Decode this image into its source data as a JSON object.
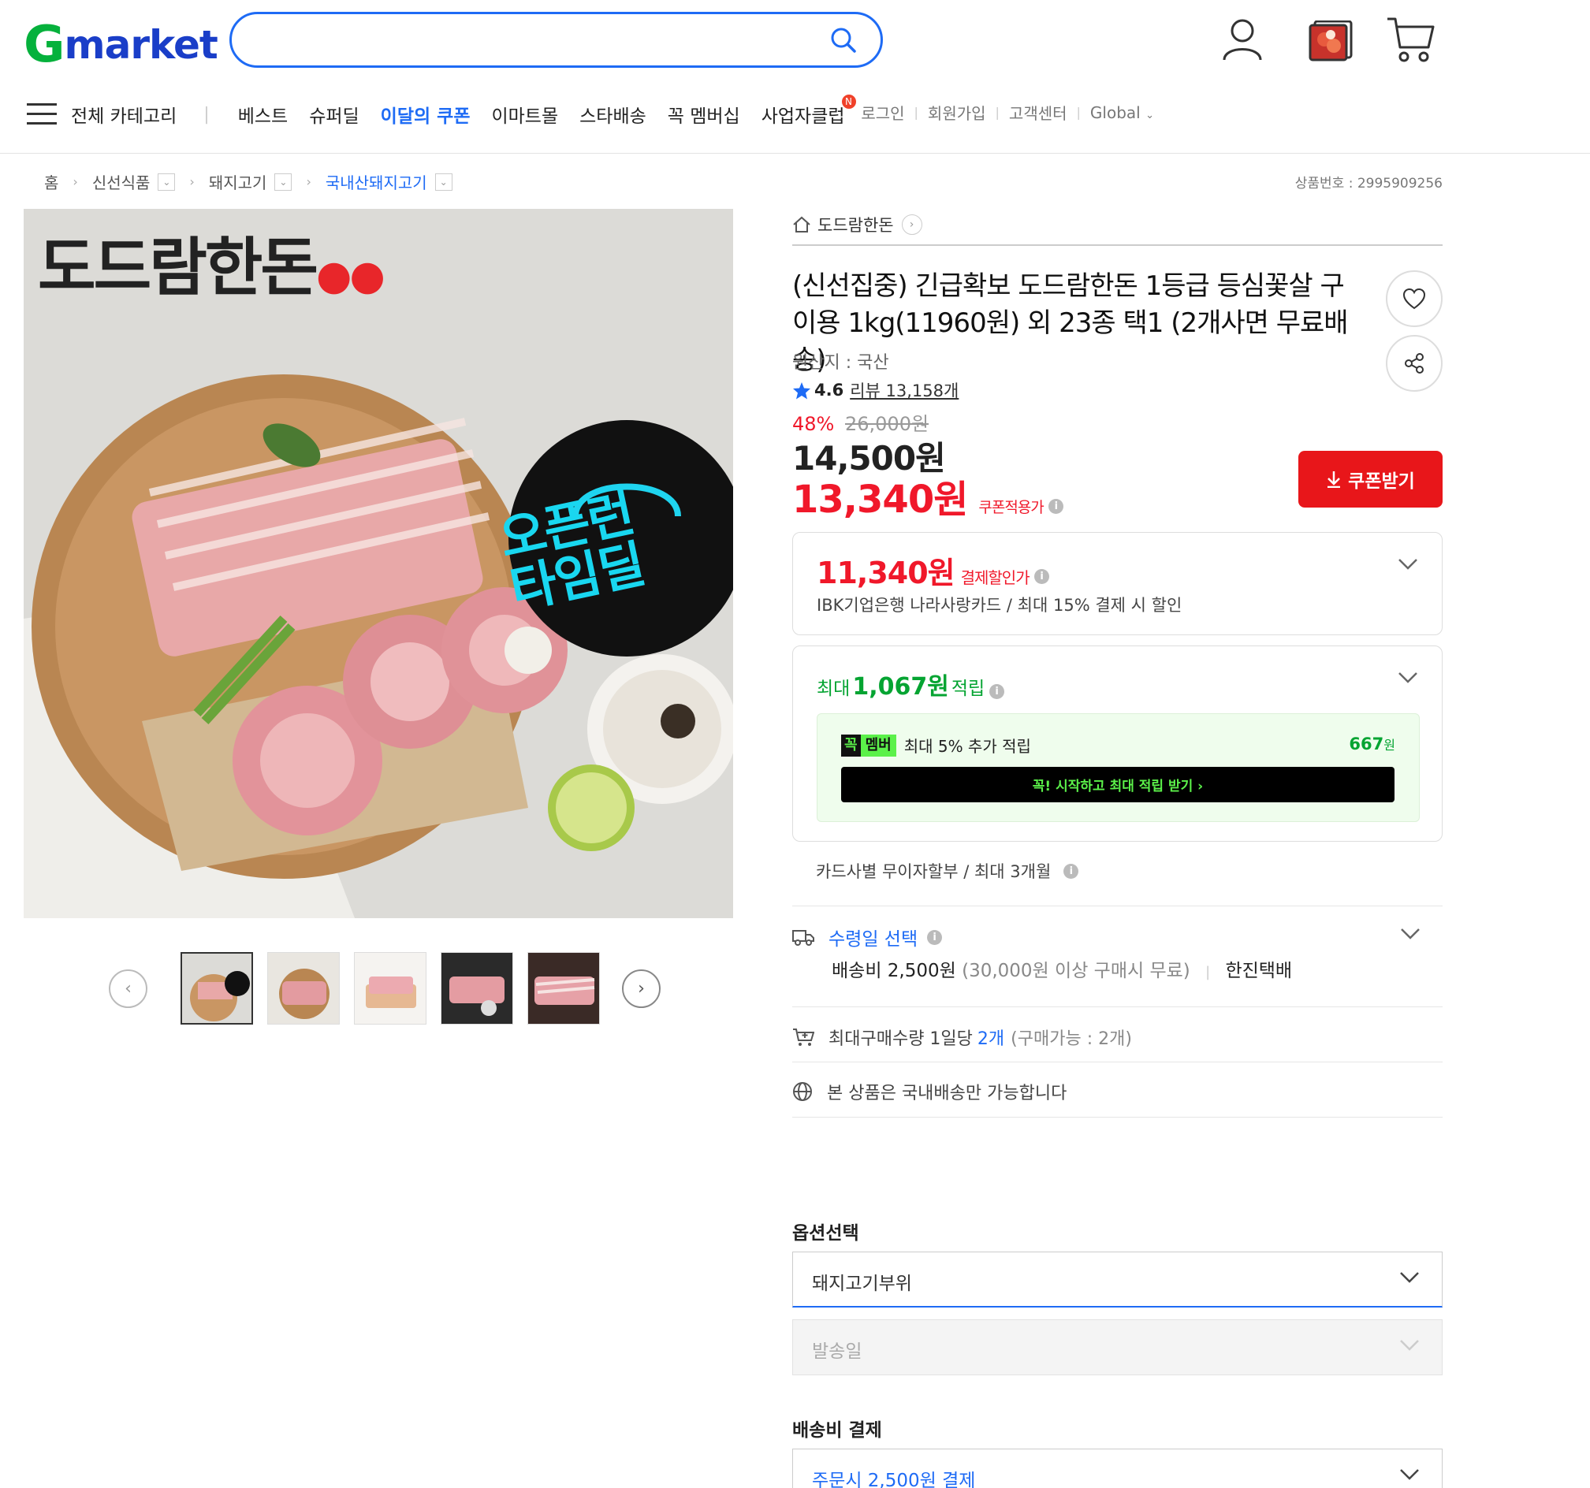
{
  "header": {
    "logo_g": "G",
    "logo_rest": "market",
    "search_value": "",
    "icons": [
      "user-icon",
      "recent-item-icon",
      "cart-icon"
    ]
  },
  "nav": {
    "all_category": "전체 카테고리",
    "items": [
      "베스트",
      "슈퍼딜",
      "이달의 쿠폰",
      "이마트몰",
      "스타배송",
      "꼭 멤버십",
      "사업자클럽"
    ],
    "new_badge": "N",
    "util": [
      "로그인",
      "회원가입",
      "고객센터",
      "Global"
    ]
  },
  "breadcrumb": {
    "home": "홈",
    "items": [
      "신선식품",
      "돼지고기",
      "국내산돼지고기"
    ]
  },
  "product_number": "상품번호 : 2995909256",
  "image": {
    "brand": "도드람한돈",
    "promo_line1": "오픈런",
    "promo_line2": "타임딜"
  },
  "product": {
    "seller": "도드람한돈",
    "title": "(신선집중) 긴급확보 도드람한돈 1등급 등심꽃살 구이용 1kg(11960원) 외 23종 택1 (2개사면 무료배송)",
    "origin": "원산지 : 국산",
    "rating": "4.6",
    "review": "리뷰 13,158개",
    "discount_pct": "48%",
    "original_price": "26,000원",
    "price": "14,500원",
    "coupon_price": "13,340원",
    "coupon_price_label": "쿠폰적용가",
    "coupon_button": "쿠폰받기"
  },
  "payment_discount": {
    "price": "11,340원",
    "label": "결제할인가",
    "desc": "IBK기업은행 나라사랑카드 / 최대 15% 결제 시 할인"
  },
  "points": {
    "prefix": "최대",
    "amount": "1,067원",
    "suffix": "적립",
    "member_badge_a": "꼭",
    "member_badge_b": "멤버",
    "member_text": "최대 5% 추가 적립",
    "member_amount": "667",
    "member_amount_unit": "원",
    "member_cta": "꼭! 시작하고 최대 적립 받기 ›"
  },
  "installment": "카드사별 무이자할부 / 최대 3개월",
  "shipping": {
    "select_date": "수령일 선택",
    "fee": "배송비 2,500원",
    "free_cond": "(30,000원 이상 구매시 무료)",
    "carrier": "한진택배"
  },
  "purchase_limit": {
    "text": "최대구매수량 1일당",
    "qty": "2개",
    "available": "(구매가능 : 2개)"
  },
  "domestic_only": "본 상품은 국내배송만 가능합니다",
  "options": {
    "title": "옵션선택",
    "select1": "돼지고기부위",
    "select2": "발송일"
  },
  "shipping_payment": {
    "title": "배송비 결제",
    "value": "주문시 2,500원 결제"
  }
}
